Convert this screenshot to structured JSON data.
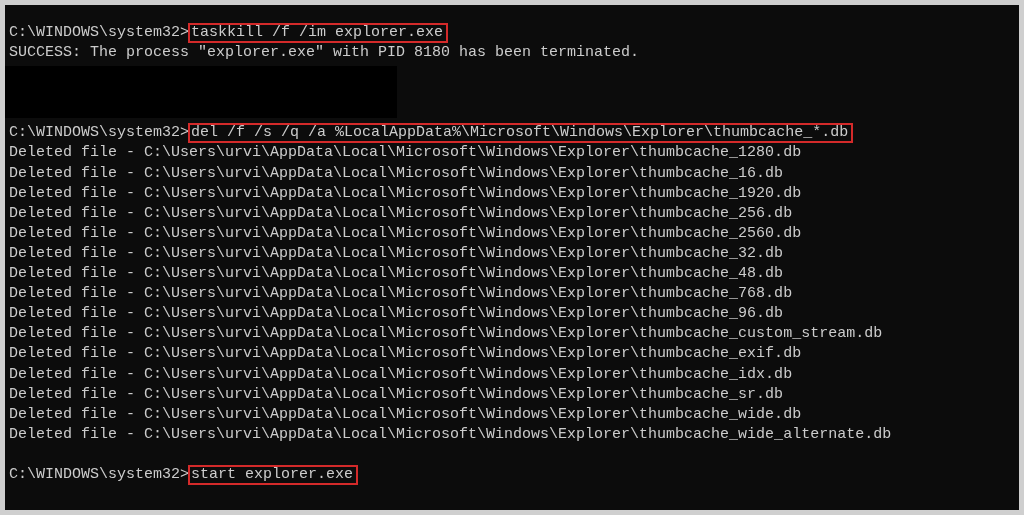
{
  "terminal": {
    "lines": [
      {
        "kind": "prompt",
        "prompt": "C:\\WINDOWS\\system32>",
        "command": "taskkill /f /im explorer.exe",
        "highlighted": true
      },
      {
        "kind": "output",
        "text": "SUCCESS: The process \"explorer.exe\" with PID 8180 has been terminated."
      },
      {
        "kind": "redacted"
      },
      {
        "kind": "blank"
      },
      {
        "kind": "prompt",
        "prompt": "C:\\WINDOWS\\system32>",
        "command": "del /f /s /q /a %LocalAppData%\\Microsoft\\Windows\\Explorer\\thumbcache_*.db",
        "highlighted": true
      },
      {
        "kind": "output",
        "text": "Deleted file - C:\\Users\\urvi\\AppData\\Local\\Microsoft\\Windows\\Explorer\\thumbcache_1280.db"
      },
      {
        "kind": "output",
        "text": "Deleted file - C:\\Users\\urvi\\AppData\\Local\\Microsoft\\Windows\\Explorer\\thumbcache_16.db"
      },
      {
        "kind": "output",
        "text": "Deleted file - C:\\Users\\urvi\\AppData\\Local\\Microsoft\\Windows\\Explorer\\thumbcache_1920.db"
      },
      {
        "kind": "output",
        "text": "Deleted file - C:\\Users\\urvi\\AppData\\Local\\Microsoft\\Windows\\Explorer\\thumbcache_256.db"
      },
      {
        "kind": "output",
        "text": "Deleted file - C:\\Users\\urvi\\AppData\\Local\\Microsoft\\Windows\\Explorer\\thumbcache_2560.db"
      },
      {
        "kind": "output",
        "text": "Deleted file - C:\\Users\\urvi\\AppData\\Local\\Microsoft\\Windows\\Explorer\\thumbcache_32.db"
      },
      {
        "kind": "output",
        "text": "Deleted file - C:\\Users\\urvi\\AppData\\Local\\Microsoft\\Windows\\Explorer\\thumbcache_48.db"
      },
      {
        "kind": "output",
        "text": "Deleted file - C:\\Users\\urvi\\AppData\\Local\\Microsoft\\Windows\\Explorer\\thumbcache_768.db"
      },
      {
        "kind": "output",
        "text": "Deleted file - C:\\Users\\urvi\\AppData\\Local\\Microsoft\\Windows\\Explorer\\thumbcache_96.db"
      },
      {
        "kind": "output",
        "text": "Deleted file - C:\\Users\\urvi\\AppData\\Local\\Microsoft\\Windows\\Explorer\\thumbcache_custom_stream.db"
      },
      {
        "kind": "output",
        "text": "Deleted file - C:\\Users\\urvi\\AppData\\Local\\Microsoft\\Windows\\Explorer\\thumbcache_exif.db"
      },
      {
        "kind": "output",
        "text": "Deleted file - C:\\Users\\urvi\\AppData\\Local\\Microsoft\\Windows\\Explorer\\thumbcache_idx.db"
      },
      {
        "kind": "output",
        "text": "Deleted file - C:\\Users\\urvi\\AppData\\Local\\Microsoft\\Windows\\Explorer\\thumbcache_sr.db"
      },
      {
        "kind": "output",
        "text": "Deleted file - C:\\Users\\urvi\\AppData\\Local\\Microsoft\\Windows\\Explorer\\thumbcache_wide.db"
      },
      {
        "kind": "output",
        "text": "Deleted file - C:\\Users\\urvi\\AppData\\Local\\Microsoft\\Windows\\Explorer\\thumbcache_wide_alternate.db"
      },
      {
        "kind": "blank"
      },
      {
        "kind": "prompt",
        "prompt": "C:\\WINDOWS\\system32>",
        "command": "start explorer.exe",
        "highlighted": true
      }
    ]
  }
}
